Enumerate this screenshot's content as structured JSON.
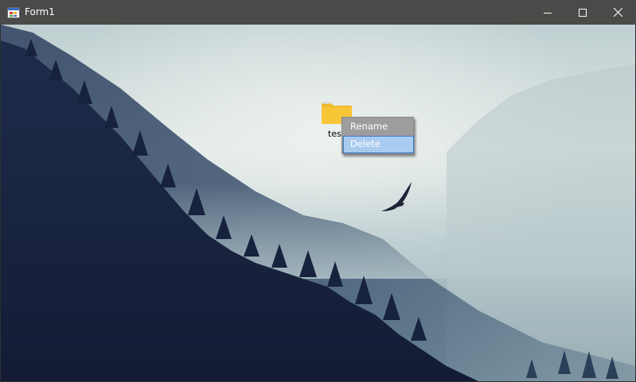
{
  "window": {
    "title": "Form1",
    "icon": "form-app-icon",
    "controls": {
      "minimize_icon": "minimize-icon",
      "maximize_icon": "maximize-icon",
      "close_icon": "close-icon"
    }
  },
  "desktop": {
    "background": "misty forest mountain with flying eagle",
    "items": [
      {
        "label": "test",
        "icon": "folder-icon",
        "color": "#f7c536"
      }
    ]
  },
  "context_menu": {
    "items": [
      {
        "label": "Rename",
        "state": "normal"
      },
      {
        "label": "Delete",
        "state": "hover"
      }
    ]
  },
  "colors": {
    "titlebar": "#4a4a48",
    "menu_bg": "#9d9d9d",
    "menu_hover": "#a9cbef",
    "menu_hover_border": "#3a78c9"
  }
}
